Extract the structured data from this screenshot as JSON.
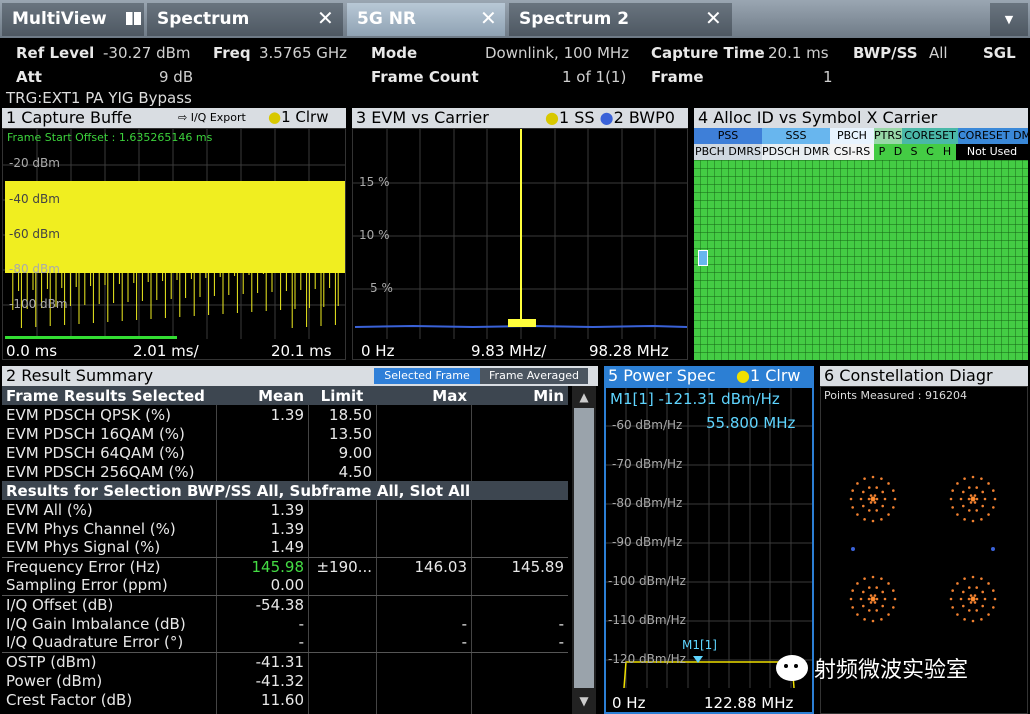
{
  "tabs": [
    {
      "label": "MultiView"
    },
    {
      "label": "Spectrum"
    },
    {
      "label": "5G NR"
    },
    {
      "label": "Spectrum 2"
    }
  ],
  "info": {
    "ref_level_label": "Ref Level",
    "ref_level": "-30.27 dBm",
    "freq_label": "Freq",
    "freq": "3.5765 GHz",
    "mode_label": "Mode",
    "mode": "Downlink, 100 MHz",
    "capture_label": "Capture Time",
    "capture": "20.1 ms",
    "bwp_label": "BWP/SS",
    "bwp": "All",
    "sgl": "SGL",
    "att_label": "Att",
    "att": "9 dB",
    "frame_count_label": "Frame Count",
    "frame_count": "1 of 1(1)",
    "frame_label": "Frame",
    "frame": "1",
    "trigger": "TRG:EXT1 PA YIG Bypass"
  },
  "capture": {
    "title": "1 Capture Buffe",
    "export": "I/Q Export",
    "trace": "1 Clrw",
    "offset": "Frame Start Offset : 1.635265146 ms",
    "y_labels": [
      "-20 dBm",
      "-40 dBm",
      "-60 dBm",
      "-80 dBm",
      "-100 dBm"
    ],
    "x_start": "0.0 ms",
    "x_div": "2.01 ms/",
    "x_end": "20.1 ms"
  },
  "evm": {
    "title": "3 EVM vs Carrier",
    "trace1": "1 SS",
    "trace2": "2 BWP0",
    "y_labels": [
      "15 %",
      "10 %",
      "5 %"
    ],
    "x_start": "0 Hz",
    "x_div": "9.83 MHz/",
    "x_end": "98.28 MHz"
  },
  "alloc": {
    "title": "4 Alloc ID vs Symbol X Carrier",
    "legend_row1": [
      "PSS",
      "SSS",
      "PBCH",
      "PTRS",
      "CORESET",
      "CORESET DMRS"
    ],
    "legend_row2": [
      "PBCH DMRS",
      "PDSCH DMRS",
      "CSI-RS",
      "P",
      "D",
      "S",
      "C",
      "H",
      "Not Used"
    ]
  },
  "summary": {
    "title": "2 Result Summary",
    "tab_selected": "Selected Frame",
    "tab_averaged": "Frame Averaged",
    "headers": [
      "Frame Results Selected",
      "Mean",
      "Limit",
      "Max",
      "Min"
    ],
    "rows1": [
      [
        "EVM PDSCH QPSK (%)",
        "1.39",
        "18.50",
        "",
        ""
      ],
      [
        "EVM PDSCH 16QAM (%)",
        "",
        "13.50",
        "",
        ""
      ],
      [
        "EVM PDSCH 64QAM (%)",
        "",
        "9.00",
        "",
        ""
      ],
      [
        "EVM PDSCH 256QAM (%)",
        "",
        "4.50",
        "",
        ""
      ]
    ],
    "section2": "Results for Selection  BWP/SS All,  Subframe All,  Slot All",
    "rows2": [
      [
        "EVM All (%)",
        "1.39",
        "",
        "",
        ""
      ],
      [
        "EVM Phys Channel (%)",
        "1.39",
        "",
        "",
        ""
      ],
      [
        "EVM Phys Signal (%)",
        "1.49",
        "",
        "",
        ""
      ],
      [
        "Frequency Error (Hz)",
        "145.98",
        "±190...",
        "146.03",
        "145.89"
      ],
      [
        "Sampling Error (ppm)",
        "0.00",
        "",
        "",
        ""
      ],
      [
        "I/Q Offset (dB)",
        "-54.38",
        "",
        "",
        ""
      ],
      [
        "I/Q Gain Imbalance (dB)",
        "-",
        "",
        "-",
        "-"
      ],
      [
        "I/Q Quadrature Error (°)",
        "-",
        "",
        "-",
        "-"
      ],
      [
        "OSTP (dBm)",
        "-41.31",
        "",
        "",
        ""
      ],
      [
        "Power (dBm)",
        "-41.32",
        "",
        "",
        ""
      ],
      [
        "Crest Factor (dB)",
        "11.60",
        "",
        "",
        ""
      ]
    ]
  },
  "power": {
    "title": "5 Power Spec",
    "trace": "1 Clrw",
    "marker": "M1[1] -121.31 dBm/Hz",
    "marker_freq": "55.800 MHz",
    "y_labels": [
      "-60 dBm/Hz",
      "-70 dBm/Hz",
      "-80 dBm/Hz",
      "-90 dBm/Hz",
      "-100 dBm/Hz",
      "-110 dBm/Hz",
      "-120 dBm/Hz"
    ],
    "marker_tag": "M1[1]",
    "x_start": "0 Hz",
    "x_end": "122.88 MHz"
  },
  "constellation": {
    "title": "6 Constellation Diagr",
    "points_label": "Points Measured :",
    "points": "916204"
  },
  "watermark": "射频微波实验室",
  "colors": {
    "tab_active": "#a9bccb",
    "panel_title": "#d9dde2",
    "yellow": "#ffff3c",
    "green": "#44cc44",
    "blue": "#3a62d8",
    "cyan": "#5fd5ff"
  }
}
